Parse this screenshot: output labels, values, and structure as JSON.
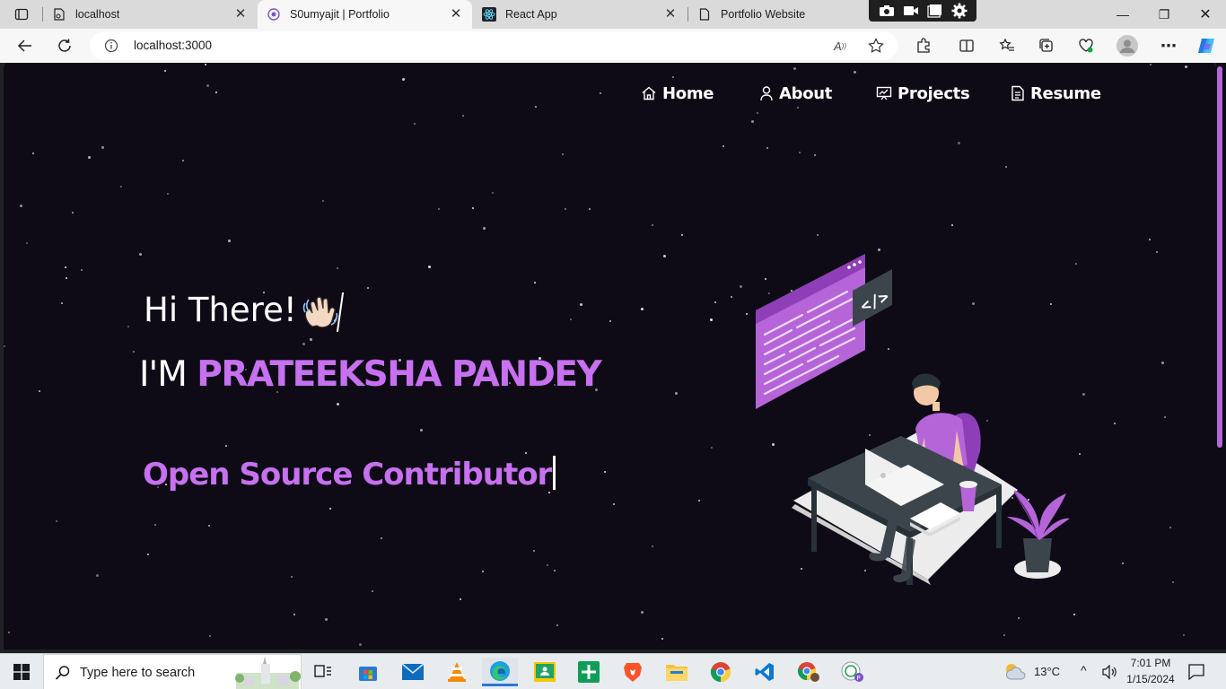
{
  "browser": {
    "tabs": [
      {
        "title": "localhost",
        "icon": "localhost-favicon-icon"
      },
      {
        "title": "S0umyajit | Portfolio",
        "icon": "portfolio-favicon-icon",
        "active": true
      },
      {
        "title": "React App",
        "icon": "react-favicon-icon"
      },
      {
        "title": "Portfolio Website",
        "icon": "document-favicon-icon"
      }
    ],
    "tab_close_glyph": "✕",
    "window_controls": {
      "minimize": "—",
      "restore": "❐",
      "close": "✕"
    },
    "url": "localhost:3000"
  },
  "page": {
    "nav": [
      {
        "label": "Home",
        "icon": "home-icon"
      },
      {
        "label": "About",
        "icon": "user-icon"
      },
      {
        "label": "Projects",
        "icon": "projects-icon"
      },
      {
        "label": "Resume",
        "icon": "document-icon"
      }
    ],
    "greeting": "Hi There!",
    "im_prefix": "I'M ",
    "name": "PRATEEKSHA PANDEY",
    "typewriter_text": "Open Source Contributor",
    "accent_color": "#c770f0",
    "background_color": "#0e0b16"
  },
  "taskbar": {
    "search_placeholder": "Type here to search",
    "weather": "13°C",
    "time": "7:01 PM",
    "date": "1/15/2024"
  }
}
